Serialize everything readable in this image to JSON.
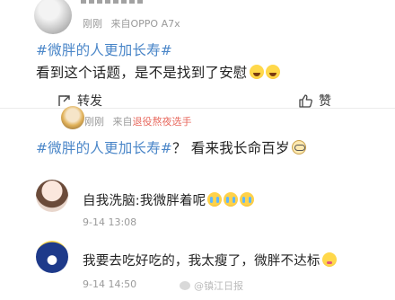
{
  "post1": {
    "username": "",
    "time": "刚刚",
    "source_prefix": "来自",
    "source": "OPPO A7x",
    "topic": "#微胖的人更加长寿#",
    "text": "看到这个话题，是不是找到了安慰",
    "emojis": [
      "laugh-cry-emoji",
      "laugh-cry-emoji"
    ],
    "repost_label": "转发",
    "like_label": "赞"
  },
  "post2": {
    "time": "刚刚",
    "source_prefix": "来自",
    "source": "退役熬夜选手",
    "topic": "#微胖的人更加长寿#",
    "text": "？ 看来我长命百岁",
    "emojis": [
      "glasses-emoji"
    ]
  },
  "comments": [
    {
      "text": "自我洗脑:我微胖着呢",
      "emojis": [
        "crying-emoji",
        "crying-emoji",
        "crying-emoji"
      ],
      "date": "9-14 13:08"
    },
    {
      "text": "我要去吃好吃的，我太瘦了，微胖不达标",
      "emojis": [
        "drooling-emoji"
      ],
      "date": "9-14 14:50"
    }
  ],
  "watermark": "@镇江日报",
  "colors": {
    "topic": "#4a86c8",
    "source_link": "#e86a5f",
    "meta": "#9a9a9a"
  }
}
